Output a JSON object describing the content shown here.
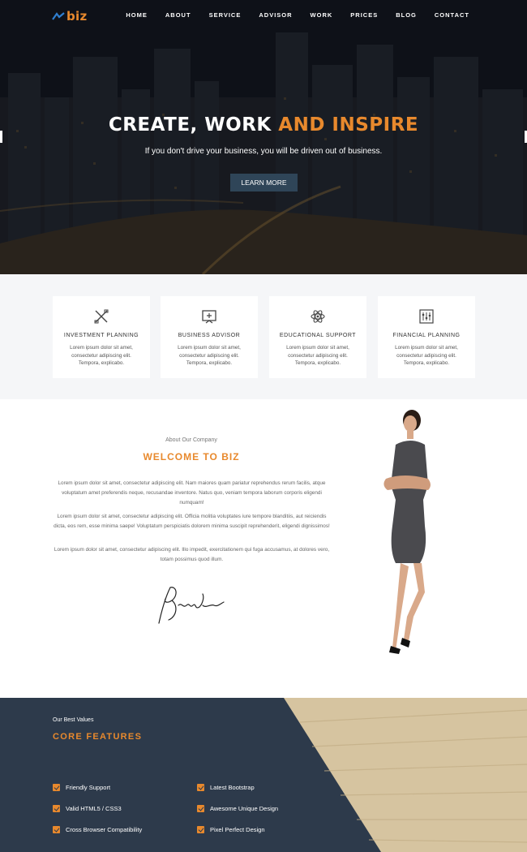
{
  "brand": {
    "logo_text": "biz",
    "accent_color": "#e8892d",
    "dark_color": "#2d3a4b"
  },
  "nav": {
    "items": [
      {
        "label": "HOME"
      },
      {
        "label": "ABOUT"
      },
      {
        "label": "SERVICE"
      },
      {
        "label": "ADVISOR"
      },
      {
        "label": "WORK"
      },
      {
        "label": "PRICES"
      },
      {
        "label": "BLOG"
      },
      {
        "label": "CONTACT"
      }
    ]
  },
  "hero": {
    "title_main": "CREATE, WORK ",
    "title_accent": "AND INSPIRE",
    "subtitle": "If you don't drive your business, you will be driven out of business.",
    "button_label": "LEARN MORE"
  },
  "services": [
    {
      "icon": "pencil-ruler-icon",
      "title": "INVESTMENT PLANNING",
      "text": "Lorem ipsum dolor sit amet, consectetur adipiscing elit. Tempora, explicabo."
    },
    {
      "icon": "presentation-board-icon",
      "title": "BUSINESS ADVISOR",
      "text": "Lorem ipsum dolor sit amet, consectetur adipiscing elit. Tempora, explicabo."
    },
    {
      "icon": "atom-icon",
      "title": "EDUCATIONAL SUPPORT",
      "text": "Lorem ipsum dolor sit amet, consectetur adipiscing elit. Tempora, explicabo."
    },
    {
      "icon": "sliders-icon",
      "title": "FINANCIAL PLANNING",
      "text": "Lorem ipsum dolor sit amet, consectetur adipiscing elit. Tempora, explicabo."
    }
  ],
  "about": {
    "kicker": "About Our Company",
    "title": "WELCOME TO BIZ",
    "paragraphs": [
      "Lorem ipsum dolor sit amet, consectetur adipiscing elit. Nam maiores quam pariatur reprehendus rerum facilis, atque voluptatum amet preferendis neque, recusandae inventore. Natus quo, veniam tempora laborum corporis eligendi numquam!",
      "Lorem ipsum dolor sit amet, consectetur adipiscing elit. Officia molitia voluptates iure tempore blanditiis, aut reiciendis dicta, eos rem, esse minima saepe! Voluptatum perspiciatis dolorem minima suscipit reprehenderit, eligendi dignissimos!",
      "Lorem ipsum dolor sit amet, consectetur adipiscing elit. Illo impedit, exercitationem qui fuga accusamus, at dolores vero, totam possimus quod illum."
    ]
  },
  "features": {
    "kicker": "Our Best Values",
    "title": "CORE FEATURES",
    "items": [
      {
        "label": "Friendly Support"
      },
      {
        "label": "Latest Bootstrap"
      },
      {
        "label": "Valid HTML5 / CSS3"
      },
      {
        "label": "Awesome Unique Design"
      },
      {
        "label": "Cross Browser Compatibility"
      },
      {
        "label": "Pixel Perfect Design"
      }
    ]
  }
}
